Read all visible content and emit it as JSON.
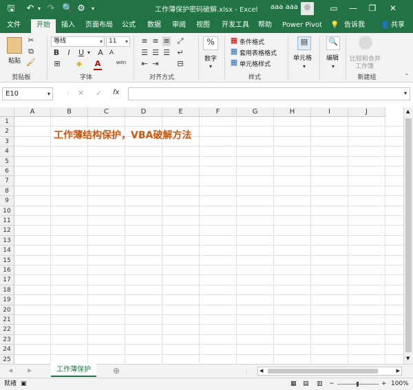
{
  "window": {
    "title": "工作薄保护密码破解.xlsx  -  Excel",
    "user": "aaa aaa"
  },
  "quick_access": {
    "save": "🖫",
    "undo": "↶",
    "redo": "↷",
    "print_preview": "🔍",
    "more": "▾"
  },
  "window_controls": {
    "options": "▭",
    "minimize": "—",
    "restore": "❐",
    "close": "✕"
  },
  "tabs": [
    "文件",
    "开始",
    "插入",
    "页面布局",
    "公式",
    "数据",
    "审阅",
    "视图",
    "开发工具",
    "帮助",
    "Power Pivot",
    "告诉我",
    "共享"
  ],
  "tell_me_icon": "💡",
  "share_icon": "👤",
  "ribbon": {
    "clipboard": {
      "paste": "粘贴",
      "label": "剪贴板"
    },
    "font": {
      "name": "等线",
      "size": "11",
      "bold": "B",
      "italic": "I",
      "underline": "U",
      "grow": "A",
      "shrink": "A",
      "label": "字体",
      "pinyin": "wén"
    },
    "align": {
      "label": "对齐方式"
    },
    "number": {
      "pct": "%",
      "label": "数字"
    },
    "styles": {
      "cond": "条件格式",
      "table": "套用表格格式",
      "cell": "单元格样式",
      "label": "样式"
    },
    "cells": {
      "label": "单元格"
    },
    "edit": {
      "label": "编辑"
    },
    "newgroup": {
      "compare": "比较和合并",
      "compare2": "工作簿",
      "label": "新建组"
    }
  },
  "formula_bar": {
    "name_box": "E10",
    "cancel": "✕",
    "enter": "✓",
    "fx": "fx"
  },
  "columns": [
    "A",
    "B",
    "C",
    "D",
    "E",
    "F",
    "G",
    "H",
    "I",
    "J"
  ],
  "rows": [
    "1",
    "2",
    "3",
    "4",
    "5",
    "6",
    "7",
    "8",
    "9",
    "10",
    "11",
    "12",
    "13",
    "14",
    "15",
    "16",
    "17",
    "18",
    "19",
    "20",
    "21",
    "22",
    "23",
    "24",
    "25"
  ],
  "cell_b2": "工作薄结构保护，VBA破解方法",
  "sheet_tab": "工作薄保护",
  "add_sheet": "⊕",
  "status": {
    "ready": "就绪",
    "zoom": "100%",
    "minus": "−",
    "plus": "+"
  },
  "colors": {
    "accent": "#217346",
    "headline": "#c65911"
  }
}
